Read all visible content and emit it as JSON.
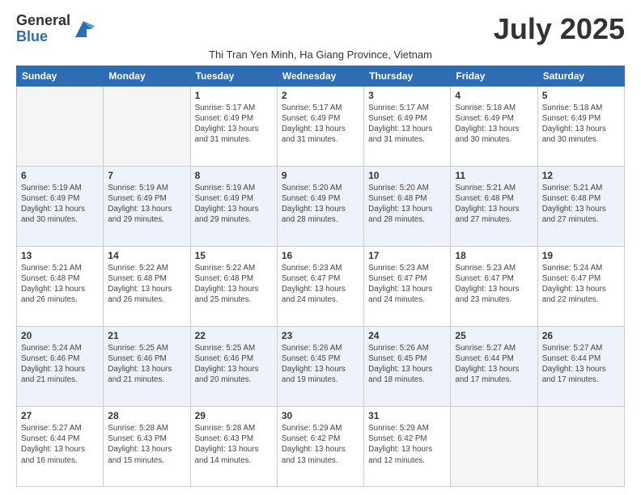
{
  "logo": {
    "general": "General",
    "blue": "Blue"
  },
  "title": "July 2025",
  "subtitle": "Thi Tran Yen Minh, Ha Giang Province, Vietnam",
  "days_of_week": [
    "Sunday",
    "Monday",
    "Tuesday",
    "Wednesday",
    "Thursday",
    "Friday",
    "Saturday"
  ],
  "weeks": [
    [
      {
        "day": "",
        "empty": true
      },
      {
        "day": "",
        "empty": true
      },
      {
        "day": "1",
        "sunrise": "5:17 AM",
        "sunset": "6:49 PM",
        "daylight": "13 hours and 31 minutes."
      },
      {
        "day": "2",
        "sunrise": "5:17 AM",
        "sunset": "6:49 PM",
        "daylight": "13 hours and 31 minutes."
      },
      {
        "day": "3",
        "sunrise": "5:17 AM",
        "sunset": "6:49 PM",
        "daylight": "13 hours and 31 minutes."
      },
      {
        "day": "4",
        "sunrise": "5:18 AM",
        "sunset": "6:49 PM",
        "daylight": "13 hours and 30 minutes."
      },
      {
        "day": "5",
        "sunrise": "5:18 AM",
        "sunset": "6:49 PM",
        "daylight": "13 hours and 30 minutes."
      }
    ],
    [
      {
        "day": "6",
        "sunrise": "5:19 AM",
        "sunset": "6:49 PM",
        "daylight": "13 hours and 30 minutes."
      },
      {
        "day": "7",
        "sunrise": "5:19 AM",
        "sunset": "6:49 PM",
        "daylight": "13 hours and 29 minutes."
      },
      {
        "day": "8",
        "sunrise": "5:19 AM",
        "sunset": "6:49 PM",
        "daylight": "13 hours and 29 minutes."
      },
      {
        "day": "9",
        "sunrise": "5:20 AM",
        "sunset": "6:49 PM",
        "daylight": "13 hours and 28 minutes."
      },
      {
        "day": "10",
        "sunrise": "5:20 AM",
        "sunset": "6:48 PM",
        "daylight": "13 hours and 28 minutes."
      },
      {
        "day": "11",
        "sunrise": "5:21 AM",
        "sunset": "6:48 PM",
        "daylight": "13 hours and 27 minutes."
      },
      {
        "day": "12",
        "sunrise": "5:21 AM",
        "sunset": "6:48 PM",
        "daylight": "13 hours and 27 minutes."
      }
    ],
    [
      {
        "day": "13",
        "sunrise": "5:21 AM",
        "sunset": "6:48 PM",
        "daylight": "13 hours and 26 minutes."
      },
      {
        "day": "14",
        "sunrise": "5:22 AM",
        "sunset": "6:48 PM",
        "daylight": "13 hours and 26 minutes."
      },
      {
        "day": "15",
        "sunrise": "5:22 AM",
        "sunset": "6:48 PM",
        "daylight": "13 hours and 25 minutes."
      },
      {
        "day": "16",
        "sunrise": "5:23 AM",
        "sunset": "6:47 PM",
        "daylight": "13 hours and 24 minutes."
      },
      {
        "day": "17",
        "sunrise": "5:23 AM",
        "sunset": "6:47 PM",
        "daylight": "13 hours and 24 minutes."
      },
      {
        "day": "18",
        "sunrise": "5:23 AM",
        "sunset": "6:47 PM",
        "daylight": "13 hours and 23 minutes."
      },
      {
        "day": "19",
        "sunrise": "5:24 AM",
        "sunset": "6:47 PM",
        "daylight": "13 hours and 22 minutes."
      }
    ],
    [
      {
        "day": "20",
        "sunrise": "5:24 AM",
        "sunset": "6:46 PM",
        "daylight": "13 hours and 21 minutes."
      },
      {
        "day": "21",
        "sunrise": "5:25 AM",
        "sunset": "6:46 PM",
        "daylight": "13 hours and 21 minutes."
      },
      {
        "day": "22",
        "sunrise": "5:25 AM",
        "sunset": "6:46 PM",
        "daylight": "13 hours and 20 minutes."
      },
      {
        "day": "23",
        "sunrise": "5:26 AM",
        "sunset": "6:45 PM",
        "daylight": "13 hours and 19 minutes."
      },
      {
        "day": "24",
        "sunrise": "5:26 AM",
        "sunset": "6:45 PM",
        "daylight": "13 hours and 18 minutes."
      },
      {
        "day": "25",
        "sunrise": "5:27 AM",
        "sunset": "6:44 PM",
        "daylight": "13 hours and 17 minutes."
      },
      {
        "day": "26",
        "sunrise": "5:27 AM",
        "sunset": "6:44 PM",
        "daylight": "13 hours and 17 minutes."
      }
    ],
    [
      {
        "day": "27",
        "sunrise": "5:27 AM",
        "sunset": "6:44 PM",
        "daylight": "13 hours and 16 minutes."
      },
      {
        "day": "28",
        "sunrise": "5:28 AM",
        "sunset": "6:43 PM",
        "daylight": "13 hours and 15 minutes."
      },
      {
        "day": "29",
        "sunrise": "5:28 AM",
        "sunset": "6:43 PM",
        "daylight": "13 hours and 14 minutes."
      },
      {
        "day": "30",
        "sunrise": "5:29 AM",
        "sunset": "6:42 PM",
        "daylight": "13 hours and 13 minutes."
      },
      {
        "day": "31",
        "sunrise": "5:29 AM",
        "sunset": "6:42 PM",
        "daylight": "13 hours and 12 minutes."
      },
      {
        "day": "",
        "empty": true
      },
      {
        "day": "",
        "empty": true
      }
    ]
  ]
}
